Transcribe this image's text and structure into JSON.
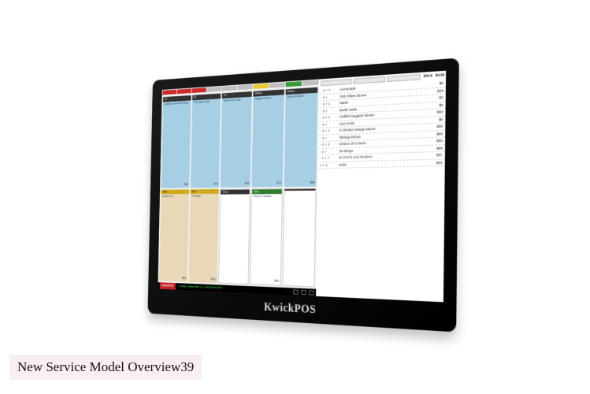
{
  "brand": "KwickPOS",
  "caption": "New Service Model Overview39",
  "tabHeaders": [
    {
      "label": "T4",
      "cls": "red"
    },
    {
      "label": "T5",
      "cls": "red"
    },
    {
      "label": "T9",
      "cls": "red"
    },
    {
      "label": "Online",
      "cls": ""
    },
    {
      "label": "Online",
      "cls": ""
    },
    {
      "label": "",
      "cls": ""
    },
    {
      "label": "",
      "cls": "yel"
    },
    {
      "label": "",
      "cls": ""
    },
    {
      "label": "Dine",
      "cls": "grn"
    },
    {
      "label": "",
      "cls": ""
    }
  ],
  "cards": [
    {
      "hdr": "T4",
      "hdrCls": "",
      "body": "Catfish\nLemonade\nWings",
      "price": "$66"
    },
    {
      "hdr": "T5",
      "hdrCls": "",
      "body": "Fish Fillets\nSoda",
      "price": "$48"
    },
    {
      "hdr": "T9",
      "hdrCls": "",
      "body": "Water\nCan Soda",
      "price": "$33"
    },
    {
      "hdr": "Online",
      "hdrCls": "",
      "body": "Nuggets Dinner",
      "price": "$72"
    },
    {
      "hdr": "Online",
      "hdrCls": "",
      "body": "Shrimp Dinner",
      "price": "$54"
    },
    {
      "hdr": "Dine",
      "hdrCls": "yel",
      "body": "Choice of 2",
      "price": "$60",
      "cardCls": "tan"
    },
    {
      "hdr": "Dine",
      "hdrCls": "yel",
      "body": "75 Wings",
      "price": "$120",
      "cardCls": "tan"
    },
    {
      "hdr": "ToGo",
      "hdrCls": "",
      "body": "",
      "price": "",
      "cardCls": "white"
    },
    {
      "hdr": "Dine",
      "hdrCls": "grn",
      "body": "Perch & Tenders",
      "price": "$82",
      "cardCls": "white"
    },
    {
      "hdr": "",
      "hdrCls": "",
      "body": "",
      "price": "",
      "cardCls": "white"
    }
  ],
  "status": {
    "logo": "KwickPOS",
    "text": "Friday, September 11, 2020 03:46 PM"
  },
  "order": {
    "totals": [
      "$21.6",
      "$4.34"
    ],
    "lines": [
      {
        "qty": "- 1 + 1",
        "name": "Lemonade",
        "amt": "$6"
      },
      {
        "qty": "- 1 +",
        "name": "Fish Fillets Dinner",
        "amt": "$28"
      },
      {
        "qty": "- 1 + 1",
        "name": "Water",
        "amt": "$3"
      },
      {
        "qty": "- 2 +",
        "name": "Bottle Soda",
        "amt": "$6"
      },
      {
        "qty": "- 3 + 1",
        "name": "Catfish Nuggets Dinner",
        "amt": "$60"
      },
      {
        "qty": "- 1 +",
        "name": "Can Soda",
        "amt": "$6"
      },
      {
        "qty": "- 1 + 1",
        "name": "4 Chicken Wings Dinner",
        "amt": "$60"
      },
      {
        "qty": "- 1 +",
        "name": "Shrimp Dinner",
        "amt": "$66"
      },
      {
        "qty": "- 1 + 1",
        "name": "Choice Of 2 Items",
        "amt": "$60"
      },
      {
        "qty": "- 1 +",
        "name": "75 Wings",
        "amt": "$66"
      },
      {
        "qty": "- 1 + 1",
        "name": "#2 Perch And Tenders",
        "amt": "$81"
      },
      {
        "qty": "<  + 1",
        "name": "Coke",
        "amt": "$21"
      }
    ]
  }
}
